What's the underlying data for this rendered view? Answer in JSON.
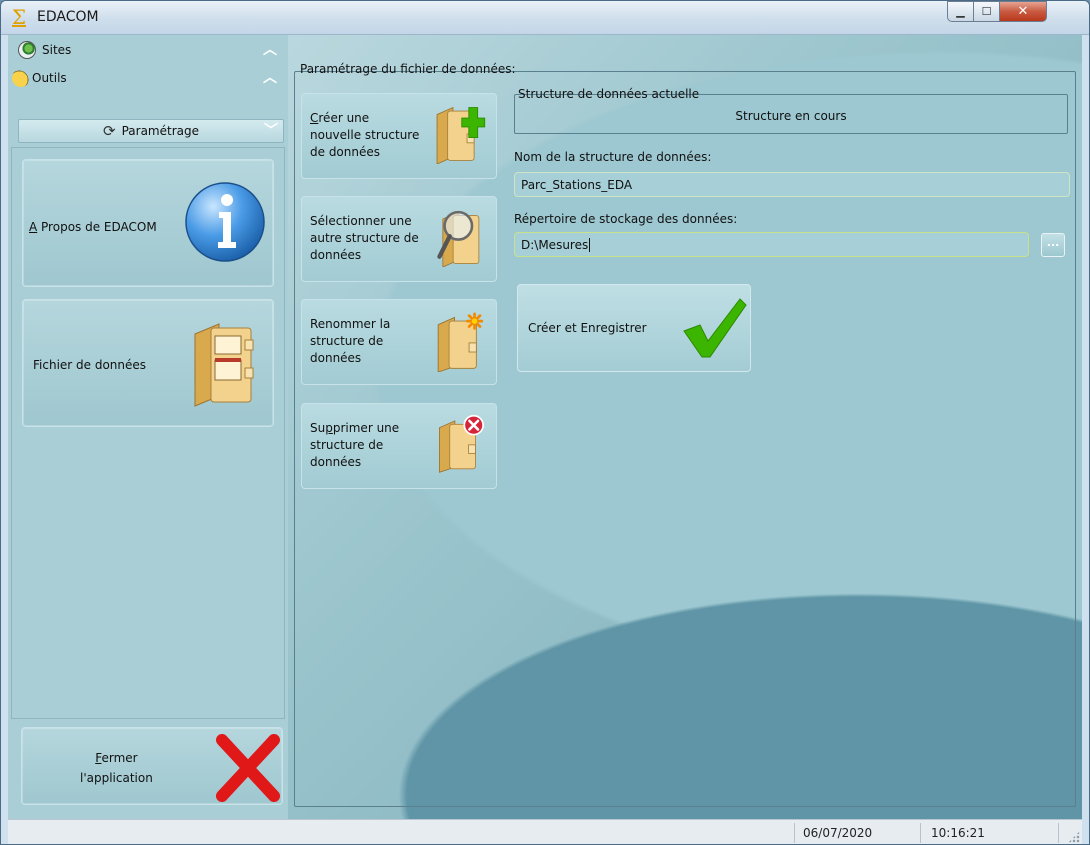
{
  "window": {
    "title": "EDACOM",
    "min_glyph": "▁",
    "max_glyph": "☐",
    "close_glyph": "✕"
  },
  "sidebar": {
    "sections": [
      {
        "label": "Sites",
        "icon": "leaf-globe-icon"
      },
      {
        "label": "Outils",
        "icon": "tools-icon"
      }
    ],
    "active_section": {
      "label": "Paramétrage",
      "icon": "settings-spinner-icon"
    },
    "buttons": [
      {
        "label_first": "A",
        "label_rest": " Propos de EDACOM",
        "icon": "info-icon"
      },
      {
        "label": "Fichier de données",
        "icon": "data-file-folder-icon"
      }
    ],
    "close_button": {
      "label_line1_first": "F",
      "label_line1_rest": "ermer",
      "label_line2": "l'application",
      "icon": "red-cross-icon"
    }
  },
  "main": {
    "group_title": "Paramétrage du fichier de données:",
    "actions": [
      {
        "label_first": "C",
        "label_rest": "réer une nouvelle structure de données",
        "icon": "folder-add-icon"
      },
      {
        "label": "Sélectionner une autre structure de données",
        "icon": "folder-search-icon"
      },
      {
        "label": "Renommer la structure de données",
        "icon": "folder-rename-icon"
      },
      {
        "label_pre": "Su",
        "label_underline": "p",
        "label_rest": "primer une structure de données",
        "icon": "folder-delete-icon"
      }
    ],
    "current_structure": {
      "title": "Structure de données actuelle",
      "value": "Structure en cours"
    },
    "name_field": {
      "label": "Nom de la structure de données:",
      "value": "Parc_Stations_EDA"
    },
    "directory_field": {
      "label": "Répertoire de stockage des données:",
      "value": "D:\\Mesures",
      "browse_label": "..."
    },
    "save_button": {
      "label": "Créer et Enregistrer",
      "icon": "green-check-icon"
    }
  },
  "statusbar": {
    "date": "06/07/2020",
    "time": "10:16:21"
  },
  "colors": {
    "accent_green": "#3cb500",
    "close_red": "#e02020",
    "folder_tan": "#e8c27a"
  }
}
